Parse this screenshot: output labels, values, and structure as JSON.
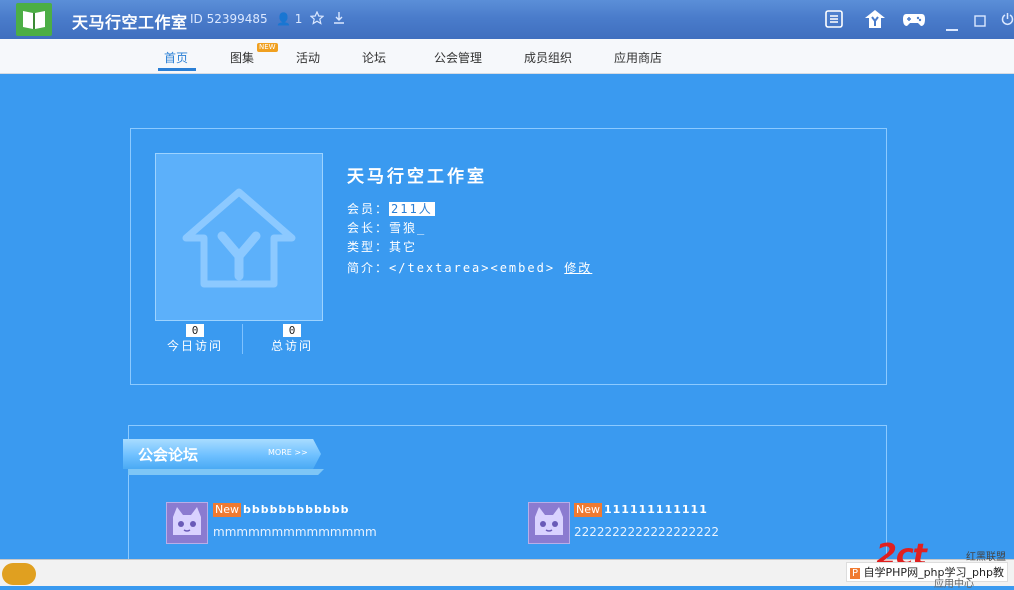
{
  "window": {
    "title": "天马行空工作室",
    "id_label": "ID 52399485",
    "member_count": "1"
  },
  "nav": {
    "items": [
      "首页",
      "图集",
      "活动",
      "论坛",
      "公会管理",
      "成员组织",
      "应用商店"
    ],
    "new_badge": "NEW"
  },
  "profile": {
    "name": "天马行空工作室",
    "members_label": "会员：",
    "members_value": "211人",
    "leader_label": "会长：",
    "leader_value": "雪狼_",
    "type_label": "类型：",
    "type_value": "其它",
    "intro_label": "简介：",
    "intro_value": "</textarea><embed>",
    "edit_link": "修改",
    "today_visits_label": "今日访问",
    "today_visits_value": "0",
    "total_visits_label": "总访问",
    "total_visits_value": "0"
  },
  "forum": {
    "title": "公会论坛",
    "more": "MORE >>",
    "posts": [
      {
        "badge": "New",
        "title": "bbbbbbbbbbbb",
        "body": "mmmmmmmmmmmmmm"
      },
      {
        "badge": "New",
        "title": "111111111111",
        "body": "2222222222222222222"
      }
    ]
  },
  "watermark": {
    "text": "自学PHP网_php学习_php教",
    "site": "红黑联盟",
    "red_text": "2ct",
    "ghost": "应用中心"
  },
  "colors": {
    "background": "#3a9af0",
    "accent": "#2a7fd5",
    "new_badge": "#f07a30"
  }
}
